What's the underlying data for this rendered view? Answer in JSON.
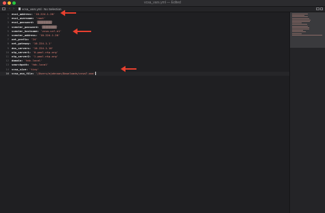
{
  "window": {
    "title": "vcsa_vars.yml — Edited"
  },
  "tabbar": {
    "filename": "vcsa_vars.yml",
    "selection": "No Selection"
  },
  "editor": {
    "current_line": 16,
    "lines": [
      {
        "num": "1",
        "key": "esxi_address:",
        "val": "'10.224.1.20'"
      },
      {
        "num": "2",
        "key": "esxi_username:",
        "val": "'root'"
      },
      {
        "num": "3",
        "key": "esxi_password:",
        "val": "'█████████'"
      },
      {
        "num": "4",
        "key": "vcenter_password:",
        "val": "'█████████'"
      },
      {
        "num": "5",
        "key": "vcenter_hostname:",
        "val": "'vcsa-vcf-e1'"
      },
      {
        "num": "6",
        "key": "vcenter_address:",
        "val": "'10.224.1.20'"
      },
      {
        "num": "7",
        "key": "net_prefix:",
        "val": "'24'"
      },
      {
        "num": "8",
        "key": "net_gateway:",
        "val": "'10.224.1.1'"
      },
      {
        "num": "9",
        "key": "dns_servers:",
        "val": "'10.224.1.10'"
      },
      {
        "num": "10",
        "key": "ntp_server1:",
        "val": "'0.pool.ntp.org'"
      },
      {
        "num": "11",
        "key": "ntp_server2:",
        "val": "'1.pool.ntp.org'"
      },
      {
        "num": "12",
        "key": "domain:",
        "val": "'hdc.local'"
      },
      {
        "num": "13",
        "key": "searchpath:",
        "val": "'hdc.local'"
      },
      {
        "num": "14",
        "key": "vcsa_size:",
        "val": "'tiny'"
      },
      {
        "num": "16",
        "key": "vcsa_ova_file:",
        "val": "'/Users/ejohnson/Downloads/vcsa7.ova'"
      }
    ]
  },
  "colors": {
    "key": "#e6e6e6",
    "value": "#f08a7e",
    "arrow": "#e8402f",
    "background": "#1f1f22"
  },
  "annotations": [
    "arrow-pointing-at-esxi-address",
    "arrow-pointing-at-vcenter-hostname",
    "arrow-pointing-at-vcsa-ova-file"
  ]
}
